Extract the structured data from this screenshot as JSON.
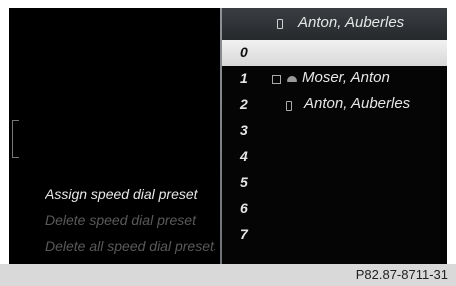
{
  "menu": {
    "items": [
      {
        "label": "Assign speed dial preset",
        "state": "active"
      },
      {
        "label": "Delete speed dial preset",
        "state": "disabled"
      },
      {
        "label": "Delete all speed dial presets",
        "state": "disabled"
      }
    ]
  },
  "contact_header": {
    "name": "Anton, Auberles",
    "icon": "mobile-phone-icon"
  },
  "speed_dial": {
    "selected_index": 0,
    "rows": [
      {
        "number": "0",
        "name": ""
      },
      {
        "number": "1",
        "name": "Moser, Anton",
        "icons": [
          "office-phone-icon",
          "home-phone-icon"
        ]
      },
      {
        "number": "2",
        "name": "Anton, Auberles",
        "icons": [
          "mobile-phone-icon"
        ]
      },
      {
        "number": "3",
        "name": ""
      },
      {
        "number": "4",
        "name": ""
      },
      {
        "number": "5",
        "name": ""
      },
      {
        "number": "6",
        "name": ""
      },
      {
        "number": "7",
        "name": ""
      }
    ]
  },
  "caption": "P82.87-8711-31"
}
